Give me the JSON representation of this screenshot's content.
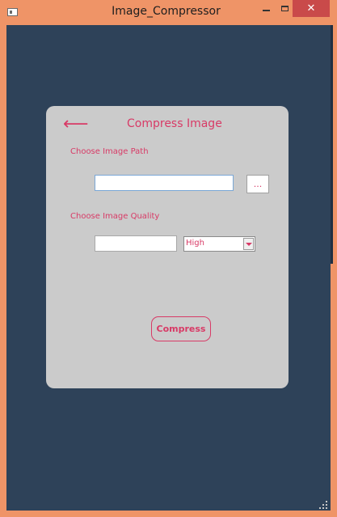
{
  "window": {
    "title": "Image_Compressor",
    "close_glyph": "✕",
    "icons": {
      "app": "app-window-icon",
      "minimize": "minimize-icon",
      "maximize": "maximize-icon",
      "close": "close-icon"
    }
  },
  "card": {
    "back_glyph": "⟵",
    "title": "Compress Image",
    "path_label": "Choose Image Path",
    "path_value": "",
    "browse_label": "...",
    "quality_label": "Choose Image Quality",
    "quality_value": "",
    "quality_selected": "High",
    "compress_label": "Compress"
  },
  "colors": {
    "window_frame": "#ef9467",
    "client_background": "#2e4259",
    "card_background": "#cbcbcb",
    "accent": "#d83a66",
    "close_button": "#c94a4a"
  }
}
